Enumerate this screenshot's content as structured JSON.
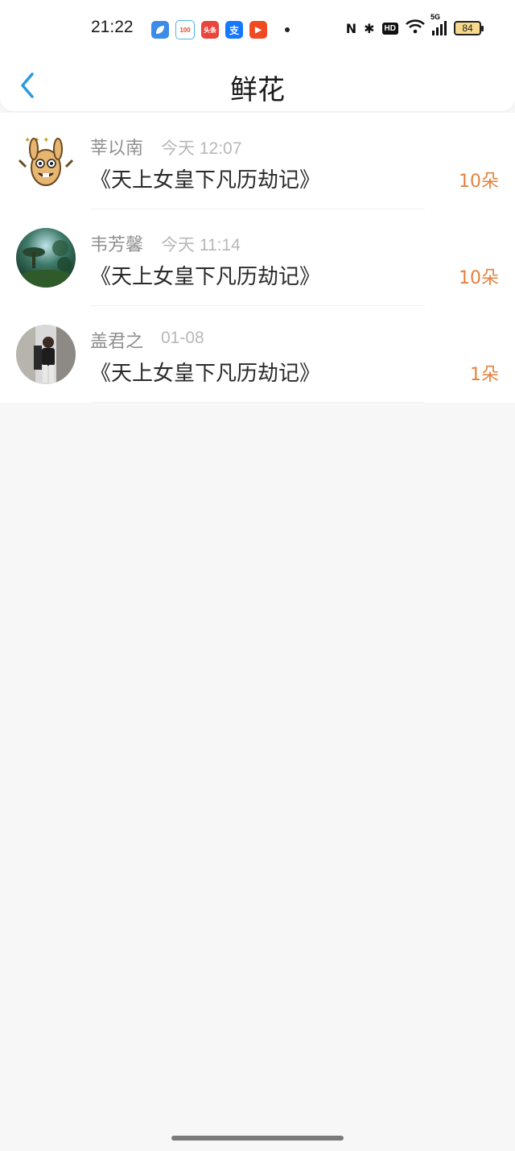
{
  "status_bar": {
    "time": "21:22",
    "app_icons": [
      {
        "name": "blue-leaf-app-icon",
        "label": "",
        "color": "#3b8be8"
      },
      {
        "name": "100-app-icon",
        "label": "100",
        "color": "#f2f2f2"
      },
      {
        "name": "toutiao-app-icon",
        "label": "头条",
        "color": "#e8453c"
      },
      {
        "name": "alipay-app-icon",
        "label": "支",
        "color": "#1677ff"
      },
      {
        "name": "video-app-icon",
        "label": "▶",
        "color": "#f04a23"
      }
    ],
    "nfc": "N",
    "bluetooth": "✱",
    "hd": "HD",
    "network": "5G",
    "battery": "84"
  },
  "header": {
    "title": "鲜花",
    "back_icon": "chevron-left-icon"
  },
  "colors": {
    "accent": "#2a9ae0",
    "count": "#e5813c",
    "background": "#f8f7f7"
  },
  "gifts": [
    {
      "name": "莘以南",
      "time": "今天 12:07",
      "book": "《天上女皇下凡历劫记》",
      "count": "10朵",
      "avatar": "cartoon-rabbit-avatar"
    },
    {
      "name": "韦芳馨",
      "time": "今天 11:14",
      "book": "《天上女皇下凡历劫记》",
      "count": "10朵",
      "avatar": "forest-scene-avatar"
    },
    {
      "name": "盖君之",
      "time": "01-08",
      "book": "《天上女皇下凡历劫记》",
      "count": "1朵",
      "avatar": "person-photo-avatar"
    }
  ]
}
